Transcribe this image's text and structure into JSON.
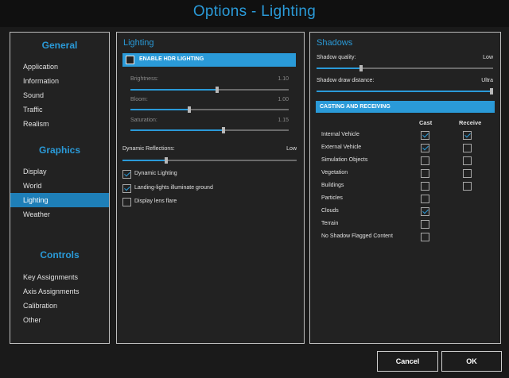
{
  "window": {
    "title": "Options - Lighting"
  },
  "sidebar": {
    "sections": [
      {
        "heading": "General",
        "items": [
          "Application",
          "Information",
          "Sound",
          "Traffic",
          "Realism"
        ]
      },
      {
        "heading": "Graphics",
        "items": [
          "Display",
          "World",
          "Lighting",
          "Weather"
        ]
      },
      {
        "heading": "Controls",
        "items": [
          "Key Assignments",
          "Axis Assignments",
          "Calibration",
          "Other"
        ]
      }
    ],
    "active_item": "Lighting"
  },
  "lighting": {
    "title": "Lighting",
    "hdr": {
      "label": "ENABLE HDR LIGHTING",
      "checked": false
    },
    "sliders": [
      {
        "label": "Brightness:",
        "value": "1.10",
        "fraction": 0.55,
        "enabled": false
      },
      {
        "label": "Bloom:",
        "value": "1.00",
        "fraction": 0.37,
        "enabled": false
      },
      {
        "label": "Saturation:",
        "value": "1.15",
        "fraction": 0.59,
        "enabled": false
      }
    ],
    "dynamic_reflections": {
      "label": "Dynamic Reflections:",
      "value": "Low",
      "fraction": 0.25
    },
    "checks": [
      {
        "label": "Dynamic Lighting",
        "checked": true
      },
      {
        "label": "Landing-lights illuminate ground",
        "checked": true
      },
      {
        "label": "Display lens flare",
        "checked": false
      }
    ]
  },
  "shadows": {
    "title": "Shadows",
    "quality": {
      "label": "Shadow quality:",
      "value": "Low",
      "fraction": 0.25
    },
    "draw_distance": {
      "label": "Shadow draw distance:",
      "value": "Ultra",
      "fraction": 1.0
    },
    "casting_header": "CASTING AND RECEIVING",
    "col_cast": "Cast",
    "col_receive": "Receive",
    "rows": [
      {
        "label": "Internal Vehicle",
        "cast": true,
        "receive": true
      },
      {
        "label": "External Vehicle",
        "cast": true,
        "receive": false
      },
      {
        "label": "Simulation Objects",
        "cast": false,
        "receive": false
      },
      {
        "label": "Vegetation",
        "cast": false,
        "receive": false
      },
      {
        "label": "Buildings",
        "cast": false,
        "receive": false
      },
      {
        "label": "Particles",
        "cast": false,
        "receive": null
      },
      {
        "label": "Clouds",
        "cast": true,
        "receive": null
      },
      {
        "label": "Terrain",
        "cast": false,
        "receive": null
      },
      {
        "label": "No Shadow Flagged Content",
        "cast": false,
        "receive": null
      }
    ]
  },
  "buttons": {
    "cancel": "Cancel",
    "ok": "OK"
  },
  "colors": {
    "accent": "#2a9ad8",
    "background": "#1a1a1a",
    "panel": "#222222"
  }
}
